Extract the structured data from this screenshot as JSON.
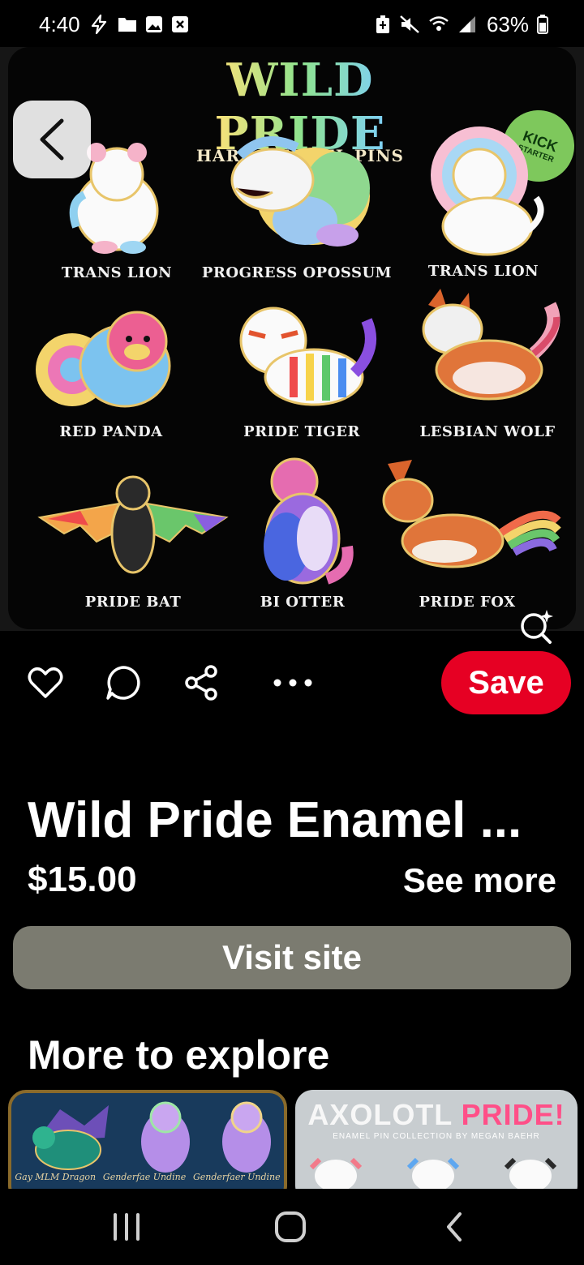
{
  "status_bar": {
    "time": "4:40",
    "battery": "63%"
  },
  "hero": {
    "title": "WILD PRIDE",
    "subtitle": "HARD ENAMEL PINS",
    "badge_line1": "KICK",
    "badge_line2": "STARTER",
    "pins": [
      {
        "label": "TRANS LION"
      },
      {
        "label": "PROGRESS OPOSSUM"
      },
      {
        "label": "TRANS LION"
      },
      {
        "label": "RED PANDA"
      },
      {
        "label": "PRIDE TIGER"
      },
      {
        "label": "LESBIAN WOLF"
      },
      {
        "label": "PRIDE BAT"
      },
      {
        "label": "BI OTTER"
      },
      {
        "label": "PRIDE FOX"
      }
    ]
  },
  "actions": {
    "save_label": "Save"
  },
  "pin_info": {
    "title": "Wild Pride Enamel ...",
    "price": "$15.00",
    "see_more": "See more",
    "visit_label": "Visit site"
  },
  "more": {
    "heading": "More to explore",
    "card1_captions": [
      "Gay MLM Dragon",
      "Genderfae Undine",
      "Genderfaer Undine"
    ],
    "card2_title_a": "AXOLOTL ",
    "card2_title_b": "PRIDE!",
    "card2_subtitle": "ENAMEL PIN COLLECTION BY MEGAN BAEHR"
  },
  "colors": {
    "save": "#e60023",
    "visit": "#7b7b70",
    "background": "#000000"
  }
}
